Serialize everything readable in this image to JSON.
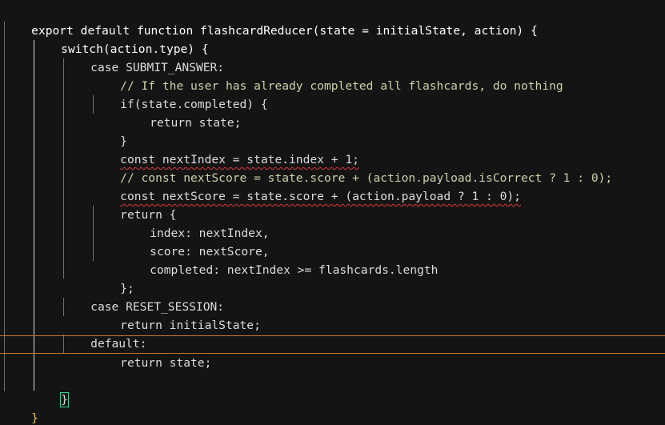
{
  "editor": {
    "lines": [
      {
        "text": "export default function flashcardReducer(state = initialState, action) {",
        "kind": "code"
      },
      {
        "text": "switch(action.type) {",
        "kind": "code"
      },
      {
        "text": "case SUBMIT_ANSWER:",
        "kind": "code"
      },
      {
        "text": "// If the user has already completed all flashcards, do nothing",
        "kind": "comment"
      },
      {
        "text": "if(state.completed) {",
        "kind": "code"
      },
      {
        "text": "return state;",
        "kind": "code"
      },
      {
        "text": "}",
        "kind": "code"
      },
      {
        "text": "const nextIndex = state.index + 1;",
        "kind": "code"
      },
      {
        "text": "// const nextScore = state.score + (action.payload.isCorrect ? 1 : 0);",
        "kind": "comment"
      },
      {
        "text": "const nextScore = state.score + (action.payload ? 1 : 0);",
        "kind": "code"
      },
      {
        "text": "return {",
        "kind": "code"
      },
      {
        "text": "index: nextIndex,",
        "kind": "code"
      },
      {
        "text": "score: nextScore,",
        "kind": "code"
      },
      {
        "text": "completed: nextIndex >= flashcards.length",
        "kind": "code"
      },
      {
        "text": "};",
        "kind": "code"
      },
      {
        "text": "case RESET_SESSION:",
        "kind": "code"
      },
      {
        "text": "return initialState;",
        "kind": "code"
      },
      {
        "text": "default:",
        "kind": "code"
      },
      {
        "text": "return state;",
        "kind": "code"
      },
      {
        "text": "",
        "kind": "code"
      },
      {
        "text": "}",
        "kind": "code"
      },
      {
        "text": "}",
        "kind": "code"
      }
    ],
    "colors": {
      "background": "#141414",
      "text": "#ffffff",
      "comment": "#c9d3a6",
      "error_squiggle": "#d83a3a",
      "current_line_border": "#c27a2a",
      "bracket_match": "#3ccf9a",
      "outer_brace": "#e9c84b"
    }
  }
}
